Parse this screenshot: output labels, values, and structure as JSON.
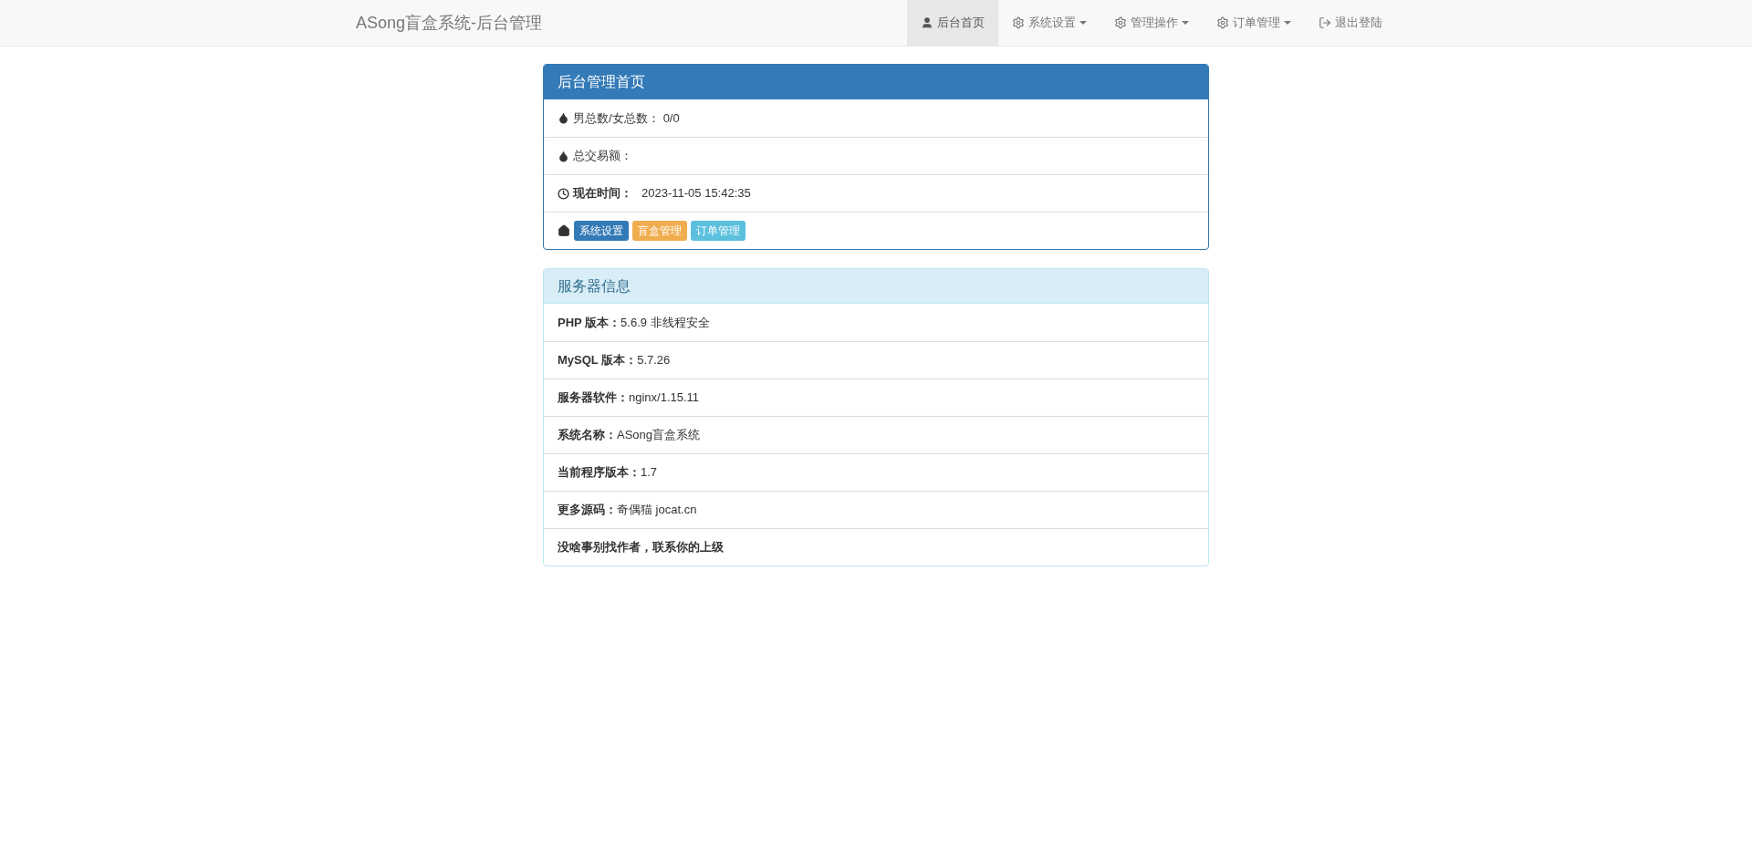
{
  "navbar": {
    "brand": "ASong盲盒系统-后台管理",
    "items": [
      {
        "label": "后台首页",
        "kind": "user",
        "dropdown": false,
        "selected": true
      },
      {
        "label": "系统设置",
        "kind": "gear",
        "dropdown": true,
        "selected": false
      },
      {
        "label": "管理操作",
        "kind": "gear",
        "dropdown": true,
        "selected": false
      },
      {
        "label": "订单管理",
        "kind": "gear",
        "dropdown": true,
        "selected": false
      },
      {
        "label": "退出登陆",
        "kind": "exit",
        "dropdown": false,
        "selected": false
      }
    ]
  },
  "overview_panel": {
    "title": "后台管理首页",
    "rows": [
      {
        "kind": "stat",
        "label": "男总数/女总数：",
        "value": "0/0"
      },
      {
        "kind": "stat",
        "label": "总交易额："
      },
      {
        "kind": "time",
        "label": "现在时间：",
        "value": "2023-11-05 15:42:35"
      },
      {
        "kind": "links",
        "badges": [
          {
            "label": "系统设置",
            "color": "#337ab7"
          },
          {
            "label": "盲盒管理",
            "color": "#f0ad4e"
          },
          {
            "label": "订单管理",
            "color": "#5bc0de"
          }
        ]
      }
    ]
  },
  "server_panel": {
    "title": "服务器信息",
    "rows": [
      {
        "label": "PHP 版本：",
        "value": "5.6.9 非线程安全"
      },
      {
        "label": "MySQL 版本：",
        "value": "5.7.26"
      },
      {
        "label": "服务器软件：",
        "value": "nginx/1.15.11"
      },
      {
        "label": "系统名称：",
        "value": "ASong盲盒系统"
      },
      {
        "label": "当前程序版本：",
        "value": "1.7"
      },
      {
        "label": "更多源码：",
        "value": "奇偶猫 jocat.cn"
      },
      {
        "label": "没啥事别找作者，联系你的上级"
      }
    ]
  }
}
